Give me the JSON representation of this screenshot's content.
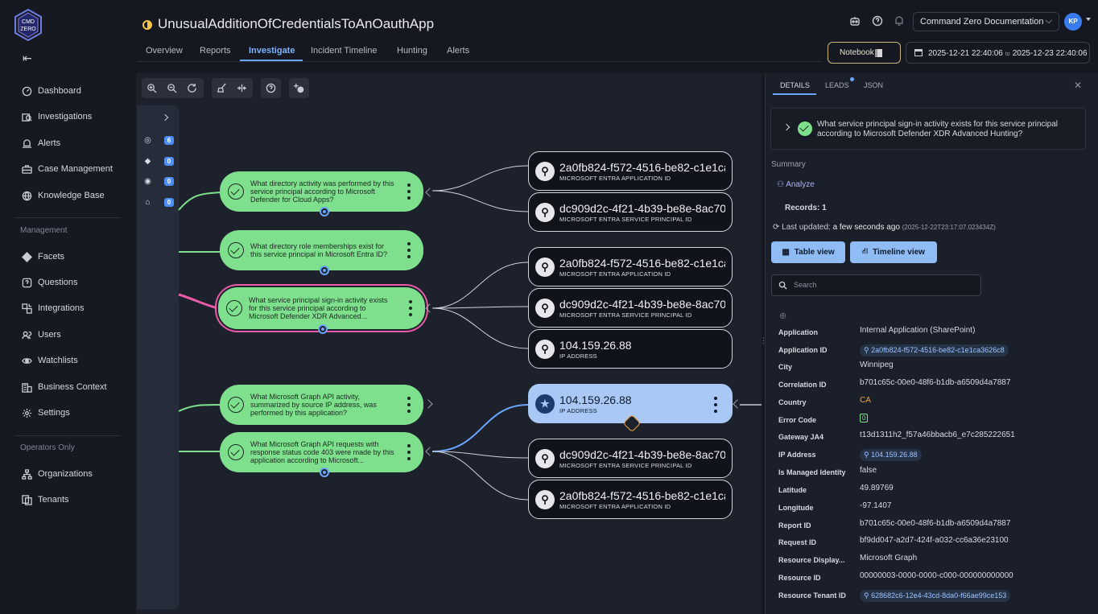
{
  "sidebar": {
    "logo_text": "CMD ZERO",
    "items": [
      {
        "label": "Dashboard",
        "icon": "gauge-icon"
      },
      {
        "label": "Investigations",
        "icon": "investigations-icon"
      },
      {
        "label": "Alerts",
        "icon": "alert-icon"
      },
      {
        "label": "Case Management",
        "icon": "briefcase-icon"
      },
      {
        "label": "Knowledge Base",
        "icon": "globe-icon"
      }
    ],
    "management_label": "Management",
    "management_items": [
      {
        "label": "Facets",
        "icon": "facet-icon"
      },
      {
        "label": "Questions",
        "icon": "question-icon"
      },
      {
        "label": "Integrations",
        "icon": "integrations-icon"
      },
      {
        "label": "Users",
        "icon": "users-icon"
      },
      {
        "label": "Watchlists",
        "icon": "eye-icon"
      },
      {
        "label": "Business Context",
        "icon": "business-icon"
      },
      {
        "label": "Settings",
        "icon": "gear-icon"
      }
    ],
    "operators_label": "Operators Only",
    "operators_items": [
      {
        "label": "Organizations",
        "icon": "org-icon"
      },
      {
        "label": "Tenants",
        "icon": "tenants-icon"
      }
    ]
  },
  "header": {
    "title": "UnusualAdditionOfCredentialsToAnOauthApp",
    "tabs": [
      "Overview",
      "Reports",
      "Investigate",
      "Incident Timeline",
      "Hunting",
      "Alerts"
    ],
    "active_tab": "Investigate",
    "doc_select": "Command Zero Documentation",
    "avatar_initials": "KP",
    "notebook_label": "Notebook",
    "date_from": "2025-12-21 22:40:06",
    "date_to_label": "to",
    "date_to": "2025-12-23 22:40:06"
  },
  "facets": [
    {
      "icon": "target-icon",
      "count": "6"
    },
    {
      "icon": "diamond-icon",
      "count": "0"
    },
    {
      "icon": "eye-icon",
      "count": "0"
    },
    {
      "icon": "tag-icon",
      "count": "0"
    }
  ],
  "graph": {
    "questions": [
      "What directory activity was performed by this service principal according to Microsoft Defender for Cloud Apps?",
      "What directory role memberships exist for this service principal in Microsoft Entra ID?",
      "What service principal sign-in activity exists for this service principal according to Microsoft Defender XDR Advanced...",
      "What Microsoft Graph API activity, summarized by source IP address, was performed by this application?",
      "What Microsoft Graph API requests with response status code 403 were made by this application according to Microsoft..."
    ],
    "entities": [
      {
        "value": "2a0fb824-f572-4516-be82-c1e1ca",
        "type": "MICROSOFT ENTRA APPLICATION ID"
      },
      {
        "value": "dc909d2c-4f21-4b39-be8e-8ac704",
        "type": "MICROSOFT ENTRA SERVICE PRINCIPAL ID"
      },
      {
        "value": "2a0fb824-f572-4516-be82-c1e1ca",
        "type": "MICROSOFT ENTRA APPLICATION ID"
      },
      {
        "value": "dc909d2c-4f21-4b39-be8e-8ac704",
        "type": "MICROSOFT ENTRA SERVICE PRINCIPAL ID"
      },
      {
        "value": "104.159.26.88",
        "type": "IP ADDRESS"
      },
      {
        "value": "104.159.26.88",
        "type": "IP ADDRESS"
      },
      {
        "value": "dc909d2c-4f21-4b39-be8e-8ac704",
        "type": "MICROSOFT ENTRA SERVICE PRINCIPAL ID"
      },
      {
        "value": "2a0fb824-f572-4516-be82-c1e1ca",
        "type": "MICROSOFT ENTRA APPLICATION ID"
      }
    ]
  },
  "details": {
    "tabs": [
      "DETAILS",
      "LEADS",
      "JSON"
    ],
    "question": "What service principal sign-in activity exists for this service principal according to Microsoft Defender XDR Advanced Hunting?",
    "summary_label": "Summary",
    "analyze_label": "Analyze",
    "records_label": "Records: 1",
    "last_updated_label": "Last updated:",
    "last_updated_value": "a few seconds ago",
    "last_updated_ts": "(2025-12-22T23:17:07.023434Z)",
    "table_view": "Table view",
    "timeline_view": "Timeline view",
    "search_placeholder": "Search",
    "fields": [
      {
        "key": "Application",
        "value": "Internal Application (SharePoint)"
      },
      {
        "key": "Application ID",
        "value": "2a0fb824-f572-4516-be82-c1e1ca3626c8",
        "chip": true
      },
      {
        "key": "City",
        "value": "Winnipeg"
      },
      {
        "key": "Correlation ID",
        "value": "b701c65c-00e0-48f6-b1db-a6509d4a7887"
      },
      {
        "key": "Country",
        "value": "CA"
      },
      {
        "key": "Error Code",
        "value": "0"
      },
      {
        "key": "Gateway JA4",
        "value": "t13d1311h2_f57a46bbacb6_e7c285222651"
      },
      {
        "key": "IP Address",
        "value": "104.159.26.88",
        "chip": true
      },
      {
        "key": "Is Managed Identity",
        "value": "false"
      },
      {
        "key": "Latitude",
        "value": "49.89769"
      },
      {
        "key": "Longitude",
        "value": "-97.1407"
      },
      {
        "key": "Report ID",
        "value": "b701c65c-00e0-48f6-b1db-a6509d4a7887"
      },
      {
        "key": "Request ID",
        "value": "bf9dd047-a2d7-424f-a032-cc6a36e23100"
      },
      {
        "key": "Resource Display...",
        "value": "Microsoft Graph"
      },
      {
        "key": "Resource ID",
        "value": "00000003-0000-0000-c000-000000000000"
      },
      {
        "key": "Resource Tenant ID",
        "value": "628682c6-12e4-43cd-8da0-f66ae99ce153",
        "chip": true
      }
    ]
  },
  "colors": {
    "accent": "#6aa6ff",
    "question_node": "#7ee08d",
    "selected_question_ring": "#e95aa8",
    "country_value": "#f0a53a",
    "error_code": "#7ee08d"
  }
}
